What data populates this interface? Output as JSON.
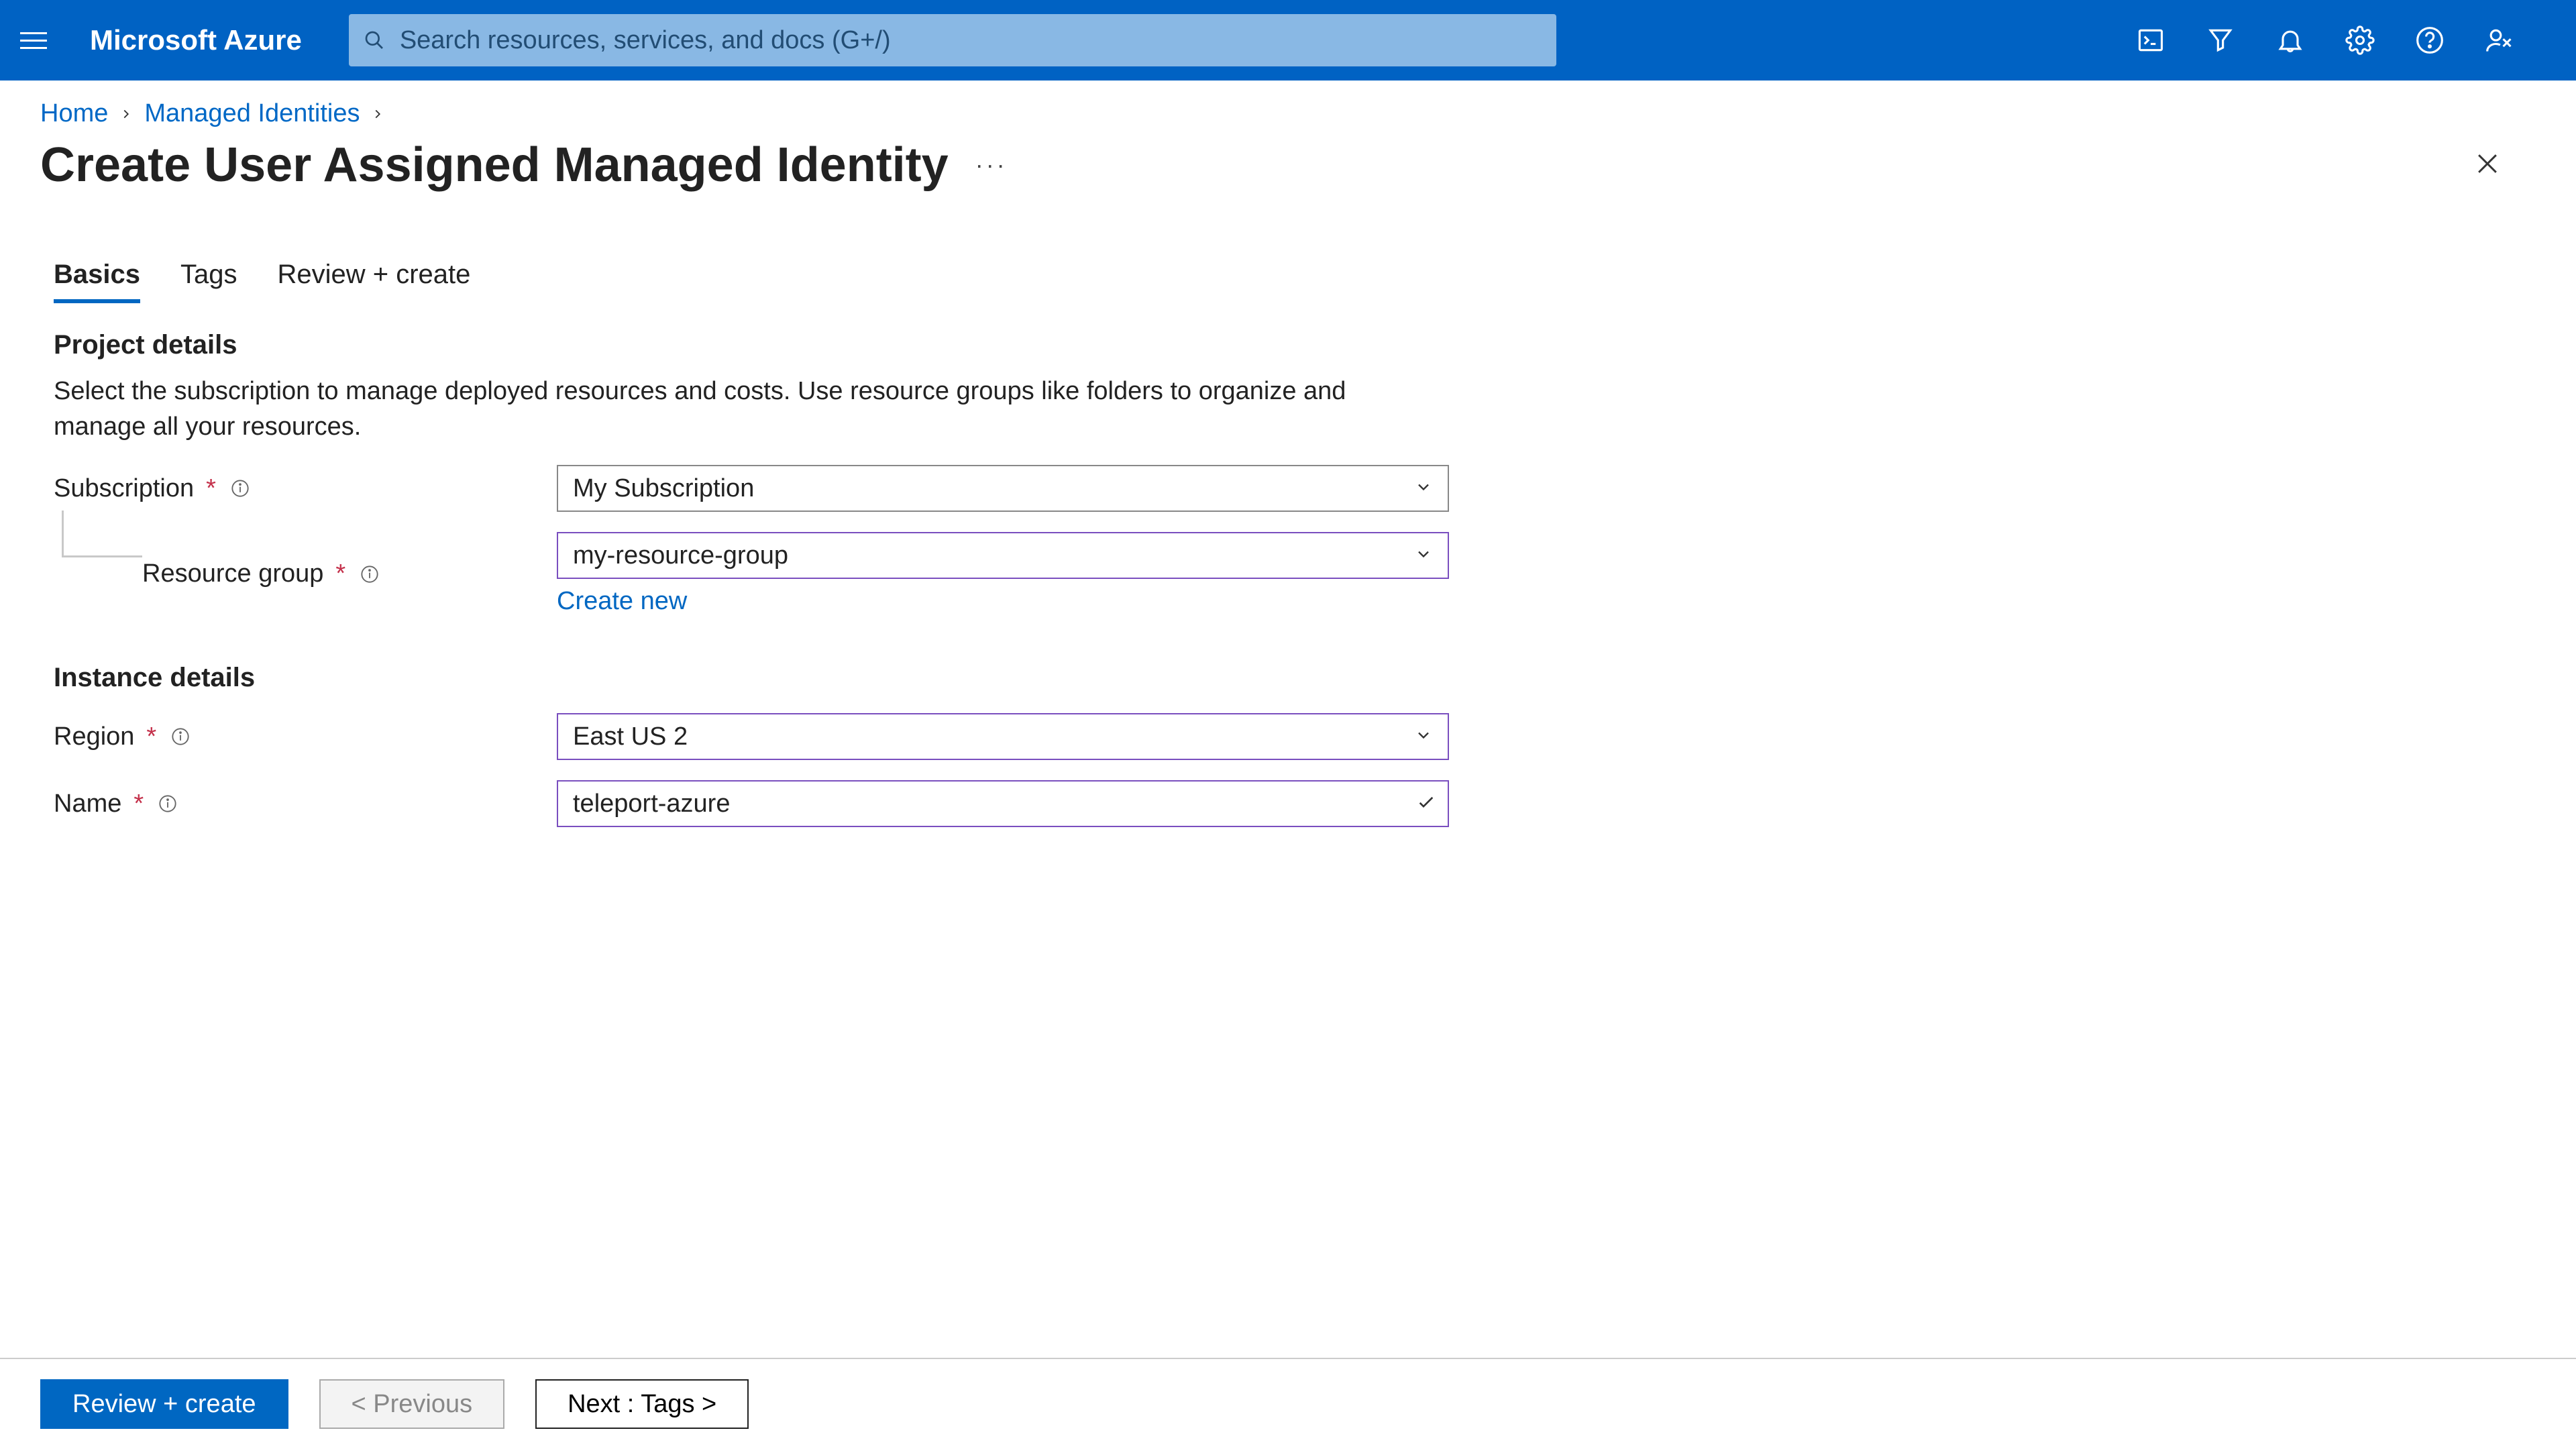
{
  "topbar": {
    "brand": "Microsoft Azure",
    "search_placeholder": "Search resources, services, and docs (G+/)"
  },
  "breadcrumb": {
    "items": [
      "Home",
      "Managed Identities"
    ]
  },
  "page": {
    "title": "Create User Assigned Managed Identity",
    "more_label": "···"
  },
  "tabs": [
    "Basics",
    "Tags",
    "Review + create"
  ],
  "sections": {
    "project_details": {
      "heading": "Project details",
      "description": "Select the subscription to manage deployed resources and costs. Use resource groups like folders to organize and manage all your resources."
    },
    "instance_details": {
      "heading": "Instance details"
    }
  },
  "fields": {
    "subscription": {
      "label": "Subscription",
      "value": "My Subscription"
    },
    "resource_group": {
      "label": "Resource group",
      "value": "my-resource-group",
      "create_new": "Create new"
    },
    "region": {
      "label": "Region",
      "value": "East US 2"
    },
    "name": {
      "label": "Name",
      "value": "teleport-azure"
    }
  },
  "footer": {
    "review": "Review + create",
    "previous": "< Previous",
    "next": "Next : Tags >"
  }
}
